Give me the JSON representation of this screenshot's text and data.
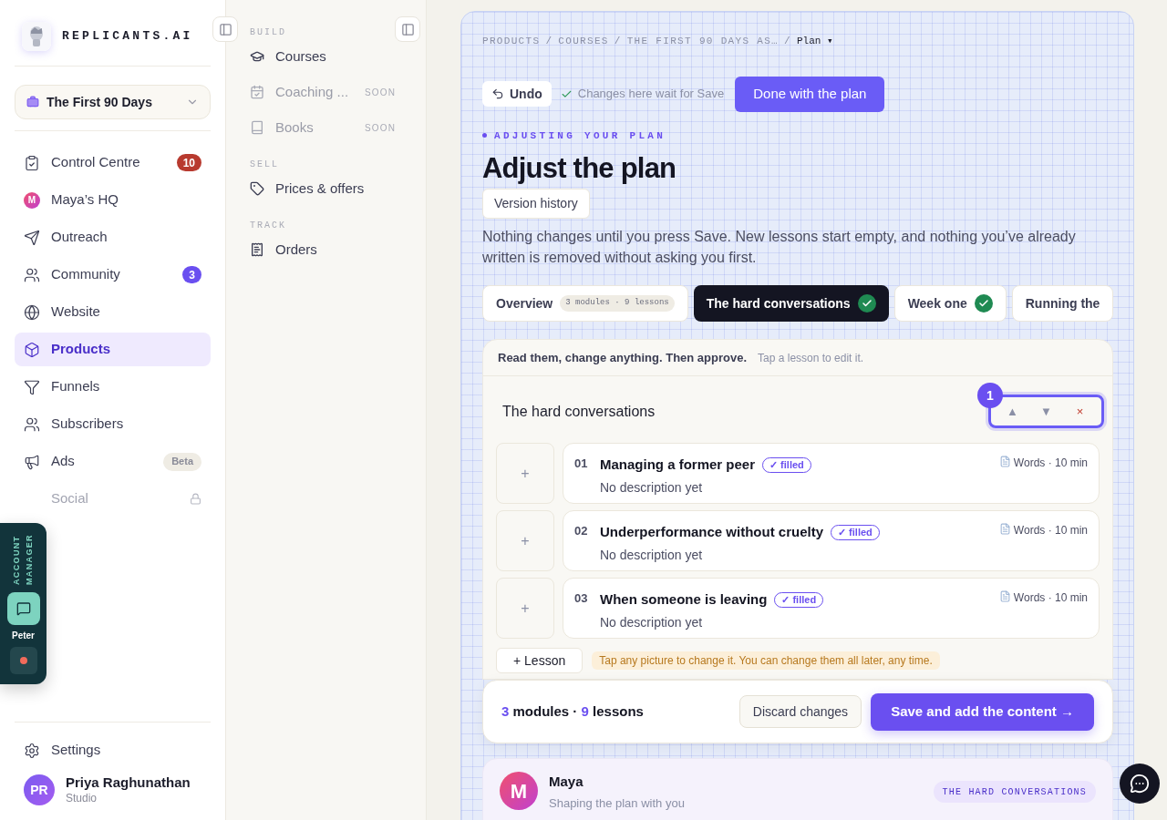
{
  "brand": {
    "name": "REPLICANTS.AI"
  },
  "workspace": {
    "label": "The First 90 Days"
  },
  "nav": [
    {
      "label": "Control Centre",
      "selected": false,
      "disabled": false,
      "badge": {
        "kind": "count",
        "text": "10",
        "color": "#b83a2f"
      }
    },
    {
      "label": "Maya’s HQ",
      "selected": false,
      "disabled": false,
      "icon_letter": "M"
    },
    {
      "label": "Outreach",
      "selected": false,
      "disabled": false
    },
    {
      "label": "Community",
      "selected": false,
      "disabled": false,
      "badge": {
        "kind": "count",
        "text": "3",
        "color": "#6a4ff0"
      }
    },
    {
      "label": "Website",
      "selected": false,
      "disabled": false
    },
    {
      "label": "Products",
      "selected": true,
      "disabled": false
    },
    {
      "label": "Funnels",
      "selected": false,
      "disabled": false
    },
    {
      "label": "Subscribers",
      "selected": false,
      "disabled": false
    },
    {
      "label": "Ads",
      "selected": false,
      "disabled": false,
      "badge": {
        "kind": "tag",
        "text": "Beta",
        "color": "#efece4"
      }
    },
    {
      "label": "Social",
      "selected": false,
      "disabled": true,
      "locked": true
    }
  ],
  "settings": {
    "label": "Settings"
  },
  "user": {
    "initials": "PR",
    "name": "Priya Raghunathan",
    "plan": "Studio"
  },
  "account_manager": {
    "title": "ACCOUNT MANAGER",
    "name": "Peter",
    "online": true
  },
  "subnav": [
    {
      "heading": "BUILD",
      "items": [
        {
          "label": "Courses",
          "disabled": false
        },
        {
          "label": "Coaching ...",
          "disabled": true,
          "tag": "SOON"
        },
        {
          "label": "Books",
          "disabled": true,
          "tag": "SOON"
        }
      ]
    },
    {
      "heading": "SELL",
      "items": [
        {
          "label": "Prices & offers",
          "disabled": false
        }
      ]
    },
    {
      "heading": "TRACK",
      "items": [
        {
          "label": "Orders",
          "disabled": false
        }
      ]
    }
  ],
  "breadcrumb": [
    {
      "label": "PRODUCTS",
      "separator": "/"
    },
    {
      "label": "COURSES",
      "separator": "/"
    },
    {
      "label": "THE FIRST 90 DAYS AS…",
      "separator": "/"
    }
  ],
  "breadcrumb_current": "Plan ▾",
  "toolbar": {
    "undo": "Undo",
    "note": "Changes here wait for Save",
    "done": "Done with the plan"
  },
  "eyebrow": "ADJUSTING YOUR PLAN",
  "title": "Adjust the plan",
  "version_history": "Version history",
  "intro": "Nothing changes until you press Save. New lessons start empty, and nothing you’ve already written is removed without asking you first.",
  "tabs": [
    {
      "label": "Overview",
      "selected": false,
      "done": false,
      "badge": "3 modules · 9 lessons"
    },
    {
      "label": "The hard conversations",
      "selected": true,
      "done": true
    },
    {
      "label": "Week one",
      "selected": false,
      "done": true
    },
    {
      "label": "Running the",
      "selected": false,
      "done": false
    }
  ],
  "panel": {
    "instruction": "Read them, change anything. Then approve.",
    "hint": "Tap a lesson to edit it."
  },
  "module": {
    "title": "The hard conversations",
    "number": "1",
    "controls": [
      {
        "kind": "move",
        "text": "▲"
      },
      {
        "kind": "move",
        "text": "▼"
      },
      {
        "kind": "delete",
        "text": "×"
      }
    ]
  },
  "lessons": [
    {
      "number": "01",
      "title": "Managing a former peer",
      "status": "✓ filled",
      "description": "No description yet",
      "meta": "Words · 10 min",
      "add": "+"
    },
    {
      "number": "02",
      "title": "Underperformance without cruelty",
      "status": "✓ filled",
      "description": "No description yet",
      "meta": "Words · 10 min",
      "add": "+"
    },
    {
      "number": "03",
      "title": "When someone is leaving",
      "status": "✓ filled",
      "description": "No description yet",
      "meta": "Words · 10 min",
      "add": "+"
    }
  ],
  "add_lesson": "+ Lesson",
  "picture_tip": "Tap any picture to change it. You can change them all later, any time.",
  "footer": {
    "modules_count": "3",
    "modules_label": "modules ·",
    "lessons_count": "9",
    "lessons_label": "lessons",
    "discard": "Discard changes",
    "save": "Save and add the content →"
  },
  "assistant": {
    "avatar": "M",
    "name": "Maya",
    "subtitle": "Shaping the plan with you",
    "tag": "THE HARD CONVERSATIONS"
  }
}
